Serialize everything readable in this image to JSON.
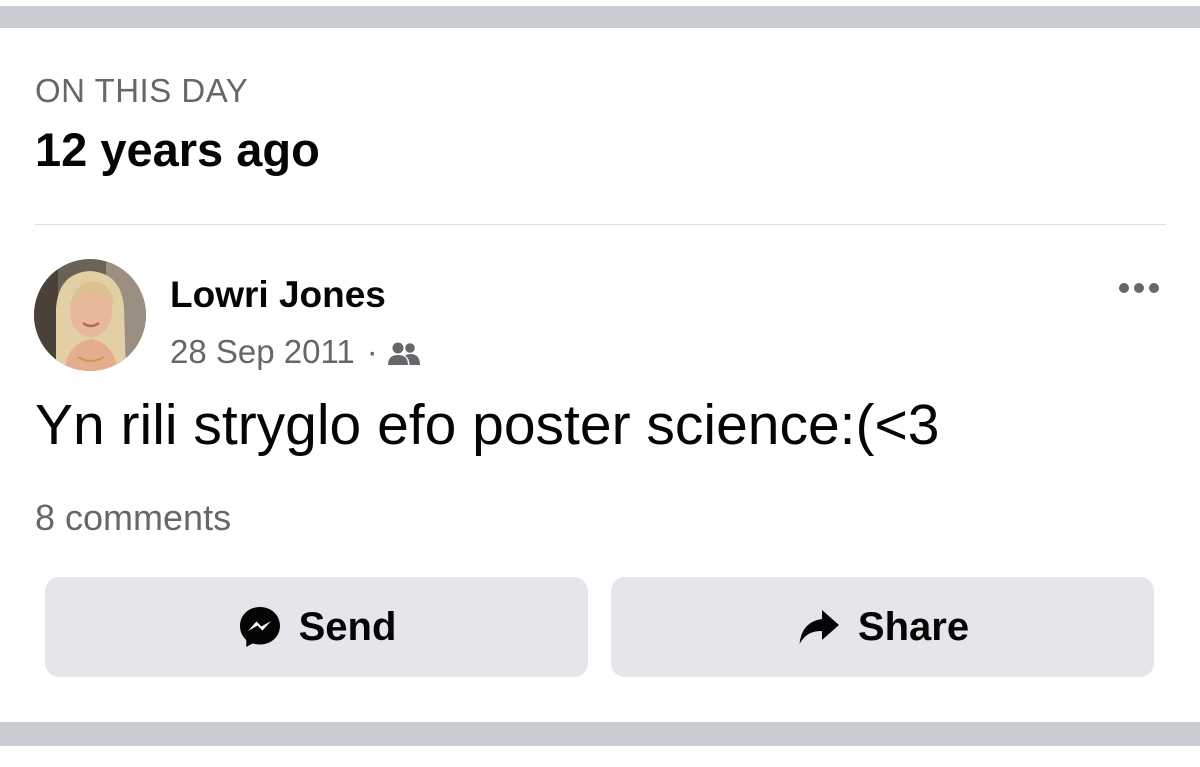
{
  "memory": {
    "section_label": "ON THIS DAY",
    "title": "12 years ago"
  },
  "post": {
    "author": "Lowri Jones",
    "date": "28 Sep 2011",
    "separator": "·",
    "audience_icon": "friends-icon",
    "more_icon": "more-options-icon",
    "text": "Yn rili stryglo efo poster science:(<3",
    "comments": "8 comments"
  },
  "actions": {
    "send_label": "Send",
    "send_icon": "messenger-icon",
    "share_label": "Share",
    "share_icon": "share-arrow-icon"
  },
  "colors": {
    "background": "#ffffff",
    "separator_bar": "#c9ccd1",
    "secondary_text": "#65676b",
    "primary_text": "#050505",
    "button_bg": "#e4e6eb"
  }
}
